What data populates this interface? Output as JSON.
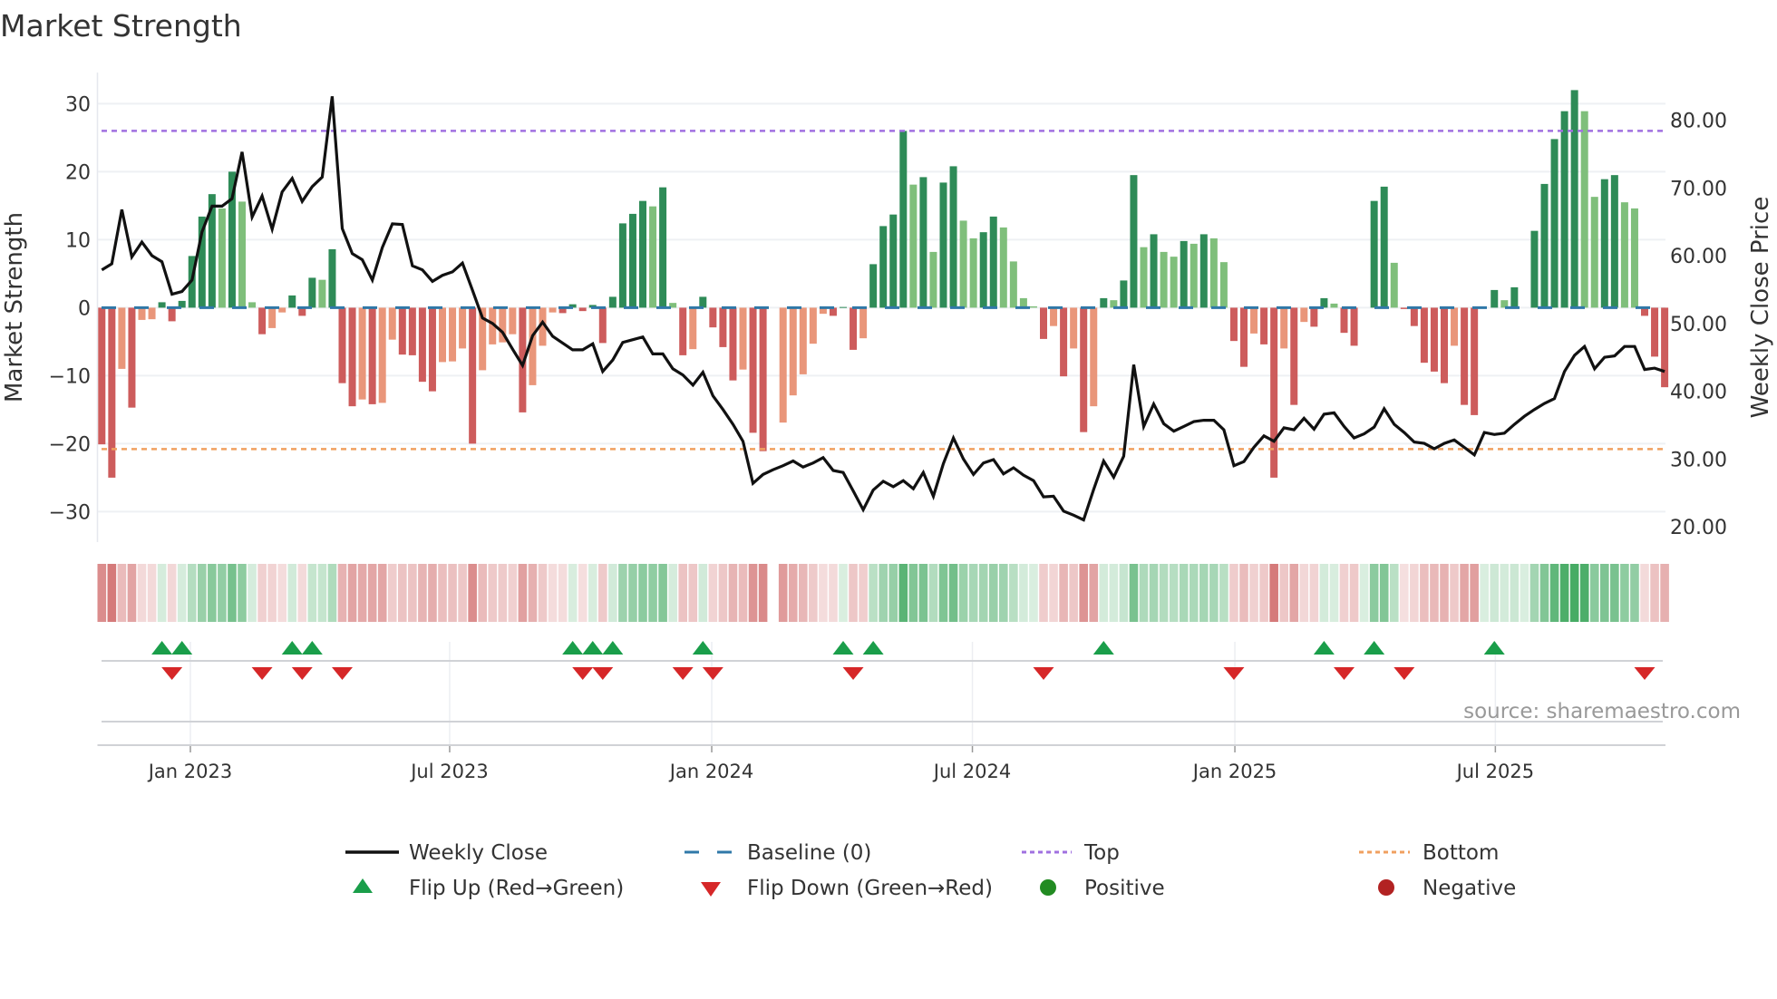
{
  "chart_data": {
    "type": "bar",
    "title": "Market Strength",
    "ylabel": "Market Strength",
    "y2label": "Weekly Close Price",
    "ylim": [
      -34,
      36
    ],
    "y2lim": [
      18.7,
      88.9
    ],
    "yticks": [
      30,
      20,
      10,
      0,
      -10,
      -20,
      -30
    ],
    "yticklabels": [
      "30",
      "20",
      "10",
      "0",
      "−10",
      "−20",
      "−30"
    ],
    "y2ticks": [
      80,
      70,
      60,
      50,
      40,
      30,
      20
    ],
    "y2ticklabels": [
      "80.00",
      "70.00",
      "60.00",
      "50.00",
      "40.00",
      "30.00",
      "20.00"
    ],
    "xunit": "week index",
    "xticks": [
      {
        "week": 8.84,
        "label": "Jan 2023"
      },
      {
        "week": 34.72,
        "label": "Jul 2023"
      },
      {
        "week": 60.88,
        "label": "Jan 2024"
      },
      {
        "week": 86.9,
        "label": "Jul 2024"
      },
      {
        "week": 113.1,
        "label": "Jan 2025"
      },
      {
        "week": 139.1,
        "label": "Jul 2025"
      }
    ],
    "top_level": 26,
    "bottom_level": -20.8,
    "baseline": 0,
    "strength": [
      -20.1,
      -25,
      -9,
      -14.7,
      -1.8,
      -1.7,
      0.8,
      -2,
      1,
      7.6,
      13.4,
      16.7,
      14.6,
      20,
      15.6,
      0.8,
      -3.9,
      -3,
      -0.7,
      1.8,
      -1.2,
      4.4,
      4.1,
      8.6,
      -11.1,
      -14.5,
      -13.5,
      -14.2,
      -14,
      -4.7,
      -6.9,
      -7,
      -10.9,
      -12.3,
      -8,
      -7.9,
      -6,
      -20,
      -9.2,
      -5.4,
      -5.1,
      -3.9,
      -15.4,
      -11.4,
      -5.6,
      -0.7,
      -0.8,
      0.5,
      -0.5,
      0.4,
      -5.2,
      1.6,
      12.4,
      13.8,
      15.7,
      14.9,
      17.7,
      0.7,
      -7,
      -6.1,
      1.6,
      -2.9,
      -5.8,
      -10.7,
      -9.1,
      -18.4,
      -21.1,
      null,
      -16.9,
      -12.9,
      -9.8,
      -5.3,
      -0.9,
      -1.2,
      0.1,
      -6.2,
      -4.5,
      6.4,
      12,
      13.7,
      26,
      18.1,
      19.2,
      8.2,
      18.4,
      20.8,
      12.8,
      10.2,
      11.1,
      13.4,
      11.8,
      6.8,
      1.4,
      0.2,
      -4.6,
      -2.7,
      -10.1,
      -6,
      -18.3,
      -14.5,
      1.4,
      1.1,
      4,
      19.5,
      8.9,
      10.8,
      8.2,
      7.5,
      9.8,
      9.4,
      10.8,
      10.2,
      6.7,
      -4.9,
      -8.7,
      -3.8,
      -5.4,
      -25,
      -6,
      -14.3,
      -2.1,
      -2.8,
      1.4,
      0.6,
      -3.7,
      -5.6,
      0,
      15.7,
      17.8,
      6.6,
      -0.2,
      -2.7,
      -8.1,
      -9.4,
      -11.1,
      -5.6,
      -14.3,
      -15.8,
      0,
      2.6,
      1.1,
      3,
      0,
      11.3,
      18.2,
      24.8,
      28.9,
      32,
      28.9,
      16.3,
      18.9,
      19.5,
      15.5,
      14.6,
      -1.2,
      -7.2,
      -11.7
    ],
    "weekly_close": [
      57.9,
      58.8,
      66.8,
      59.8,
      62.0,
      60.0,
      59.1,
      54.3,
      54.7,
      56.4,
      63.5,
      67.3,
      67.3,
      68.4,
      75.3,
      65.7,
      68.8,
      63.9,
      69.4,
      71.4,
      68.0,
      70.2,
      71.6,
      83.5,
      64.0,
      60.3,
      59.4,
      56.4,
      61.2,
      64.7,
      64.6,
      58.5,
      57.9,
      56.2,
      57.1,
      57.6,
      58.9,
      54.9,
      50.8,
      50.0,
      48.7,
      46.2,
      43.8,
      48.2,
      50.2,
      48.1,
      47.1,
      46.1,
      46.1,
      47.0,
      42.9,
      44.6,
      47.2,
      47.6,
      48.0,
      45.5,
      45.5,
      43.3,
      42.4,
      40.9,
      42.8,
      39.3,
      37.3,
      35.1,
      32.6,
      26.4,
      27.7,
      28.4,
      29.0,
      29.7,
      28.8,
      29.4,
      30.2,
      28.3,
      28.0,
      25.3,
      22.5,
      25.4,
      26.7,
      25.9,
      26.8,
      25.6,
      28.0,
      24.5,
      29.3,
      33.1,
      30.0,
      27.7,
      29.4,
      29.9,
      27.8,
      28.7,
      27.6,
      26.8,
      24.4,
      24.5,
      22.3,
      21.7,
      21.0,
      25.5,
      29.7,
      27.3,
      30.4,
      43.9,
      34.8,
      38.1,
      35.2,
      34.1,
      34.8,
      35.5,
      35.7,
      35.7,
      34.3,
      29.0,
      29.6,
      31.7,
      33.4,
      32.6,
      34.6,
      34.3,
      36.0,
      34.4,
      36.6,
      36.8,
      34.8,
      33.1,
      33.7,
      34.7,
      37.4,
      35.1,
      33.9,
      32.5,
      32.3,
      31.5,
      32.3,
      32.8,
      31.7,
      30.6,
      33.9,
      33.6,
      33.8,
      35.1,
      36.3,
      37.3,
      38.2,
      38.9,
      42.9,
      45.3,
      46.6,
      43.3,
      45.0,
      45.2,
      46.6,
      46.6,
      43.2,
      43.4,
      42.9
    ],
    "flip_up_weeks": [
      6,
      8,
      19,
      21,
      47,
      49,
      51,
      60,
      74,
      77,
      100,
      122,
      127,
      139
    ],
    "flip_down_weeks": [
      7,
      16,
      20,
      24,
      48,
      50,
      58,
      61,
      75,
      94,
      113,
      124,
      130,
      154
    ],
    "legend": {
      "placement": "bottom",
      "weekly_close": "Weekly Close",
      "baseline": "Baseline (0)",
      "top": "Top",
      "bottom": "Bottom",
      "flip_up": "Flip Up (Red→Green)",
      "flip_down": "Flip Down (Green→Red)",
      "positive": "Positive",
      "negative": "Negative"
    },
    "source": "source: sharemaestro.com",
    "colors": {
      "pos_strong": "#2e8b57",
      "pos_weak": "#7fbf7b",
      "neg_strong": "#cd5c5c",
      "neg_weak": "#e9967a",
      "close": "#111111",
      "baseline": "#2f78a8",
      "top": "#a070e0",
      "bottom": "#f0a060",
      "flip_up": "#1a9e4a",
      "flip_down": "#d62728",
      "positive": "#228b22",
      "negative": "#b22222"
    }
  }
}
